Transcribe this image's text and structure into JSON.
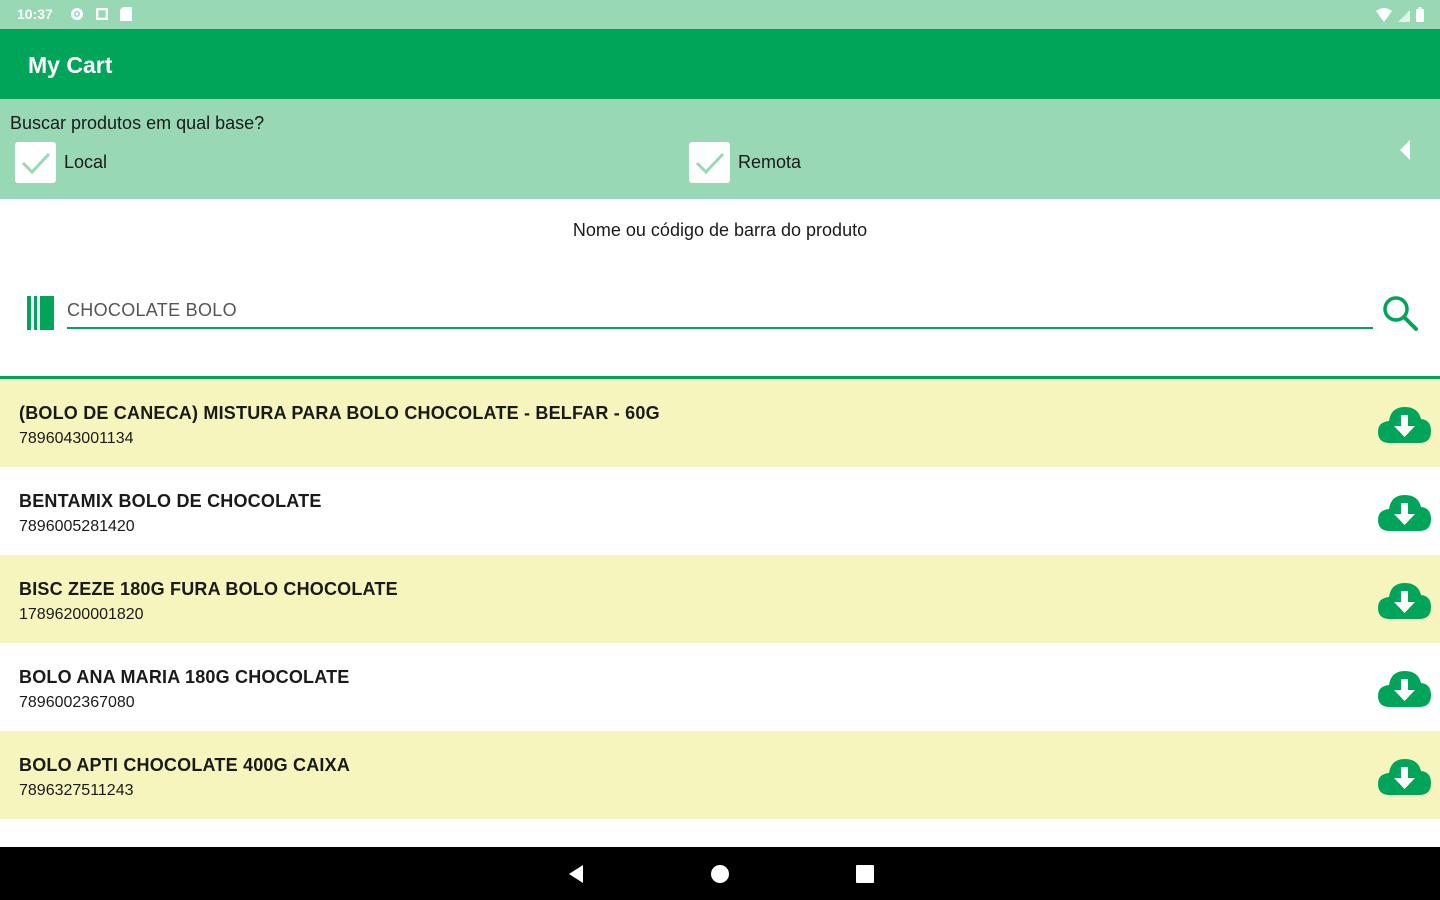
{
  "status_bar": {
    "time": "10:37"
  },
  "app_bar": {
    "title": "My Cart"
  },
  "filter": {
    "question": "Buscar produtos em qual base?",
    "options": [
      {
        "label": "Local",
        "checked": true
      },
      {
        "label": "Remota",
        "checked": true
      }
    ]
  },
  "search": {
    "caption": "Nome ou código de barra do produto",
    "value": "CHOCOLATE BOLO"
  },
  "products": [
    {
      "name": "(BOLO DE CANECA) MISTURA PARA BOLO CHOCOLATE - BELFAR - 60G",
      "code": "7896043001134"
    },
    {
      "name": "BENTAMIX BOLO DE CHOCOLATE",
      "code": "7896005281420"
    },
    {
      "name": "BISC ZEZE 180G FURA BOLO CHOCOLATE",
      "code": "17896200001820"
    },
    {
      "name": "BOLO ANA MARIA 180G CHOCOLATE",
      "code": "7896002367080"
    },
    {
      "name": "BOLO APTI CHOCOLATE 400G CAIXA",
      "code": "7896327511243"
    }
  ],
  "colors": {
    "primary": "#00a55a",
    "light_green": "#98d8b5",
    "row_highlight": "#f5f5bd"
  }
}
